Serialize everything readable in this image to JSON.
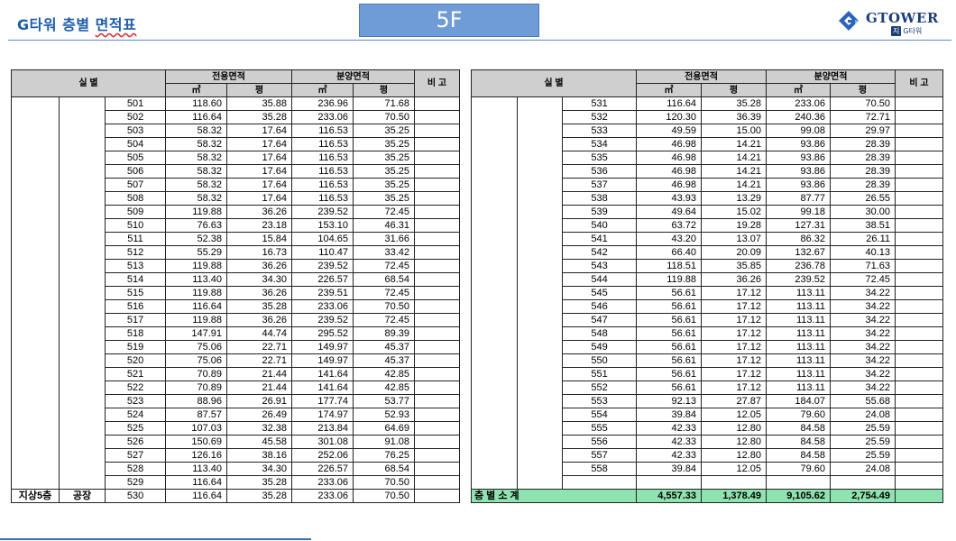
{
  "header": {
    "title_prefix": "G타워 층별 ",
    "title_underlined": "면적표",
    "floor": "5F",
    "logo_name": "GTOWER",
    "logo_badge": "지",
    "logo_sub": "G타워"
  },
  "columns": {
    "room": "실        별",
    "exclusive": "전용면적",
    "sale": "분양면적",
    "note": "비  고",
    "sqm": "㎡",
    "pyeong": "평"
  },
  "left_label": {
    "floor": "지상5층",
    "use": "공장"
  },
  "left_rows": [
    [
      "501",
      "118.60",
      "35.88",
      "236.96",
      "71.68"
    ],
    [
      "502",
      "116.64",
      "35.28",
      "233.06",
      "70.50"
    ],
    [
      "503",
      "58.32",
      "17.64",
      "116.53",
      "35.25"
    ],
    [
      "504",
      "58.32",
      "17.64",
      "116.53",
      "35.25"
    ],
    [
      "505",
      "58.32",
      "17.64",
      "116.53",
      "35.25"
    ],
    [
      "506",
      "58.32",
      "17.64",
      "116.53",
      "35.25"
    ],
    [
      "507",
      "58.32",
      "17.64",
      "116.53",
      "35.25"
    ],
    [
      "508",
      "58.32",
      "17.64",
      "116.53",
      "35.25"
    ],
    [
      "509",
      "119.88",
      "36.26",
      "239.52",
      "72.45"
    ],
    [
      "510",
      "76.63",
      "23.18",
      "153.10",
      "46.31"
    ],
    [
      "511",
      "52.38",
      "15.84",
      "104.65",
      "31.66"
    ],
    [
      "512",
      "55.29",
      "16.73",
      "110.47",
      "33.42"
    ],
    [
      "513",
      "119.88",
      "36.26",
      "239.52",
      "72.45"
    ],
    [
      "514",
      "113.40",
      "34.30",
      "226.57",
      "68.54"
    ],
    [
      "515",
      "119.88",
      "36.26",
      "239.51",
      "72.45"
    ],
    [
      "516",
      "116.64",
      "35.28",
      "233.06",
      "70.50"
    ],
    [
      "517",
      "119.88",
      "36.26",
      "239.52",
      "72.45"
    ],
    [
      "518",
      "147.91",
      "44.74",
      "295.52",
      "89.39"
    ],
    [
      "519",
      "75.06",
      "22.71",
      "149.97",
      "45.37"
    ],
    [
      "520",
      "75.06",
      "22.71",
      "149.97",
      "45.37"
    ],
    [
      "521",
      "70.89",
      "21.44",
      "141.64",
      "42.85"
    ],
    [
      "522",
      "70.89",
      "21.44",
      "141.64",
      "42.85"
    ],
    [
      "523",
      "88.96",
      "26.91",
      "177.74",
      "53.77"
    ],
    [
      "524",
      "87.57",
      "26.49",
      "174.97",
      "52.93"
    ],
    [
      "525",
      "107.03",
      "32.38",
      "213.84",
      "64.69"
    ],
    [
      "526",
      "150.69",
      "45.58",
      "301.08",
      "91.08"
    ],
    [
      "527",
      "126.16",
      "38.16",
      "252.06",
      "76.25"
    ],
    [
      "528",
      "113.40",
      "34.30",
      "226.57",
      "68.54"
    ],
    [
      "529",
      "116.64",
      "35.28",
      "233.06",
      "70.50"
    ],
    [
      "530",
      "116.64",
      "35.28",
      "233.06",
      "70.50"
    ]
  ],
  "right_rows": [
    [
      "531",
      "116.64",
      "35.28",
      "233.06",
      "70.50"
    ],
    [
      "532",
      "120.30",
      "36.39",
      "240.36",
      "72.71"
    ],
    [
      "533",
      "49.59",
      "15.00",
      "99.08",
      "29.97"
    ],
    [
      "534",
      "46.98",
      "14.21",
      "93.86",
      "28.39"
    ],
    [
      "535",
      "46.98",
      "14.21",
      "93.86",
      "28.39"
    ],
    [
      "536",
      "46.98",
      "14.21",
      "93.86",
      "28.39"
    ],
    [
      "537",
      "46.98",
      "14.21",
      "93.86",
      "28.39"
    ],
    [
      "538",
      "43.93",
      "13.29",
      "87.77",
      "26.55"
    ],
    [
      "539",
      "49.64",
      "15.02",
      "99.18",
      "30.00"
    ],
    [
      "540",
      "63.72",
      "19.28",
      "127.31",
      "38.51"
    ],
    [
      "541",
      "43.20",
      "13.07",
      "86.32",
      "26.11"
    ],
    [
      "542",
      "66.40",
      "20.09",
      "132.67",
      "40.13"
    ],
    [
      "543",
      "118.51",
      "35.85",
      "236.78",
      "71.63"
    ],
    [
      "544",
      "119.88",
      "36.26",
      "239.52",
      "72.45"
    ],
    [
      "545",
      "56.61",
      "17.12",
      "113.11",
      "34.22"
    ],
    [
      "546",
      "56.61",
      "17.12",
      "113.11",
      "34.22"
    ],
    [
      "547",
      "56.61",
      "17.12",
      "113.11",
      "34.22"
    ],
    [
      "548",
      "56.61",
      "17.12",
      "113.11",
      "34.22"
    ],
    [
      "549",
      "56.61",
      "17.12",
      "113.11",
      "34.22"
    ],
    [
      "550",
      "56.61",
      "17.12",
      "113.11",
      "34.22"
    ],
    [
      "551",
      "56.61",
      "17.12",
      "113.11",
      "34.22"
    ],
    [
      "552",
      "56.61",
      "17.12",
      "113.11",
      "34.22"
    ],
    [
      "553",
      "92.13",
      "27.87",
      "184.07",
      "55.68"
    ],
    [
      "554",
      "39.84",
      "12.05",
      "79.60",
      "24.08"
    ],
    [
      "555",
      "42.33",
      "12.80",
      "84.58",
      "25.59"
    ],
    [
      "556",
      "42.33",
      "12.80",
      "84.58",
      "25.59"
    ],
    [
      "557",
      "42.33",
      "12.80",
      "84.58",
      "25.59"
    ],
    [
      "558",
      "39.84",
      "12.05",
      "79.60",
      "24.08"
    ]
  ],
  "total": {
    "label": "층 별 소 계",
    "exclusive_sqm": "4,557.33",
    "exclusive_pyeong": "1,378.49",
    "sale_sqm": "9,105.62",
    "sale_pyeong": "2,754.49"
  }
}
